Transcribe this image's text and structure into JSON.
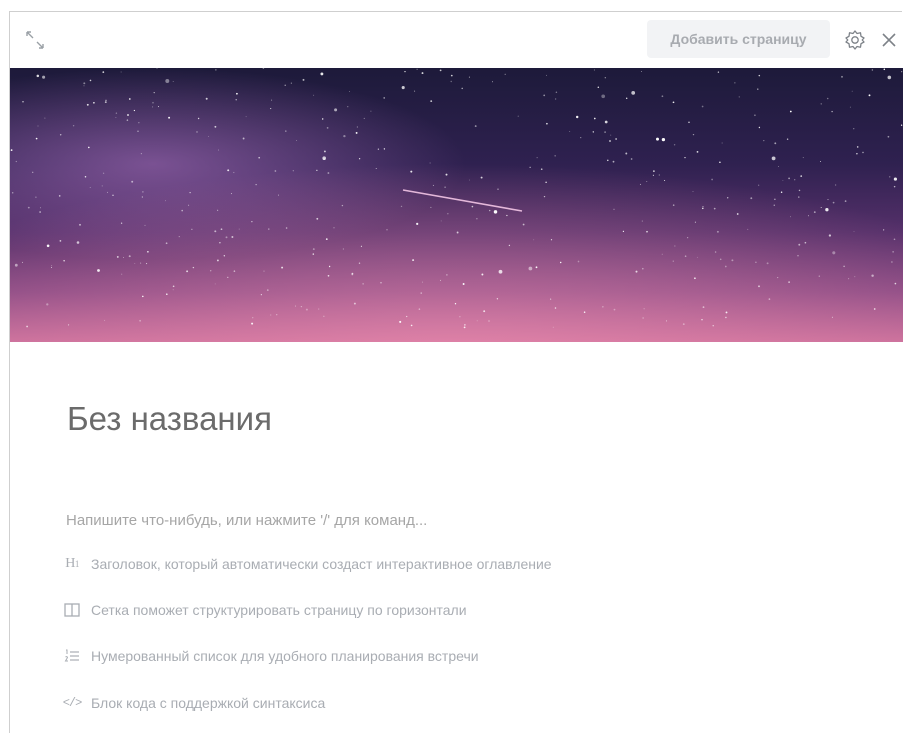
{
  "toolbar": {
    "add_page_label": "Добавить страницу",
    "icons": [
      "expand-icon",
      "gear-icon",
      "close-icon"
    ]
  },
  "cover": {
    "description_colors": [
      "#1a1838",
      "#3b2350",
      "#6a3a75",
      "#a0568a",
      "#d27aa0"
    ]
  },
  "page": {
    "title": "Без названия",
    "placeholder": "Напишите что-нибудь, или нажмите '/' для команд..."
  },
  "hints": [
    {
      "icon": "heading-icon",
      "glyph": "H",
      "label": "Заголовок, который автоматически создаст интерактивное оглавление"
    },
    {
      "icon": "grid-icon",
      "label": "Сетка поможет структурировать страницу по горизонтали"
    },
    {
      "icon": "numbered-list-icon",
      "label": "Нумерованный список для удобного планирования встречи"
    },
    {
      "icon": "code-icon",
      "glyph": "</>",
      "label": "Блок кода с поддержкой синтаксиса"
    }
  ],
  "colors": {
    "title": "#6b6b6b",
    "hint": "#a9adb3",
    "button_bg": "#f2f3f5"
  }
}
